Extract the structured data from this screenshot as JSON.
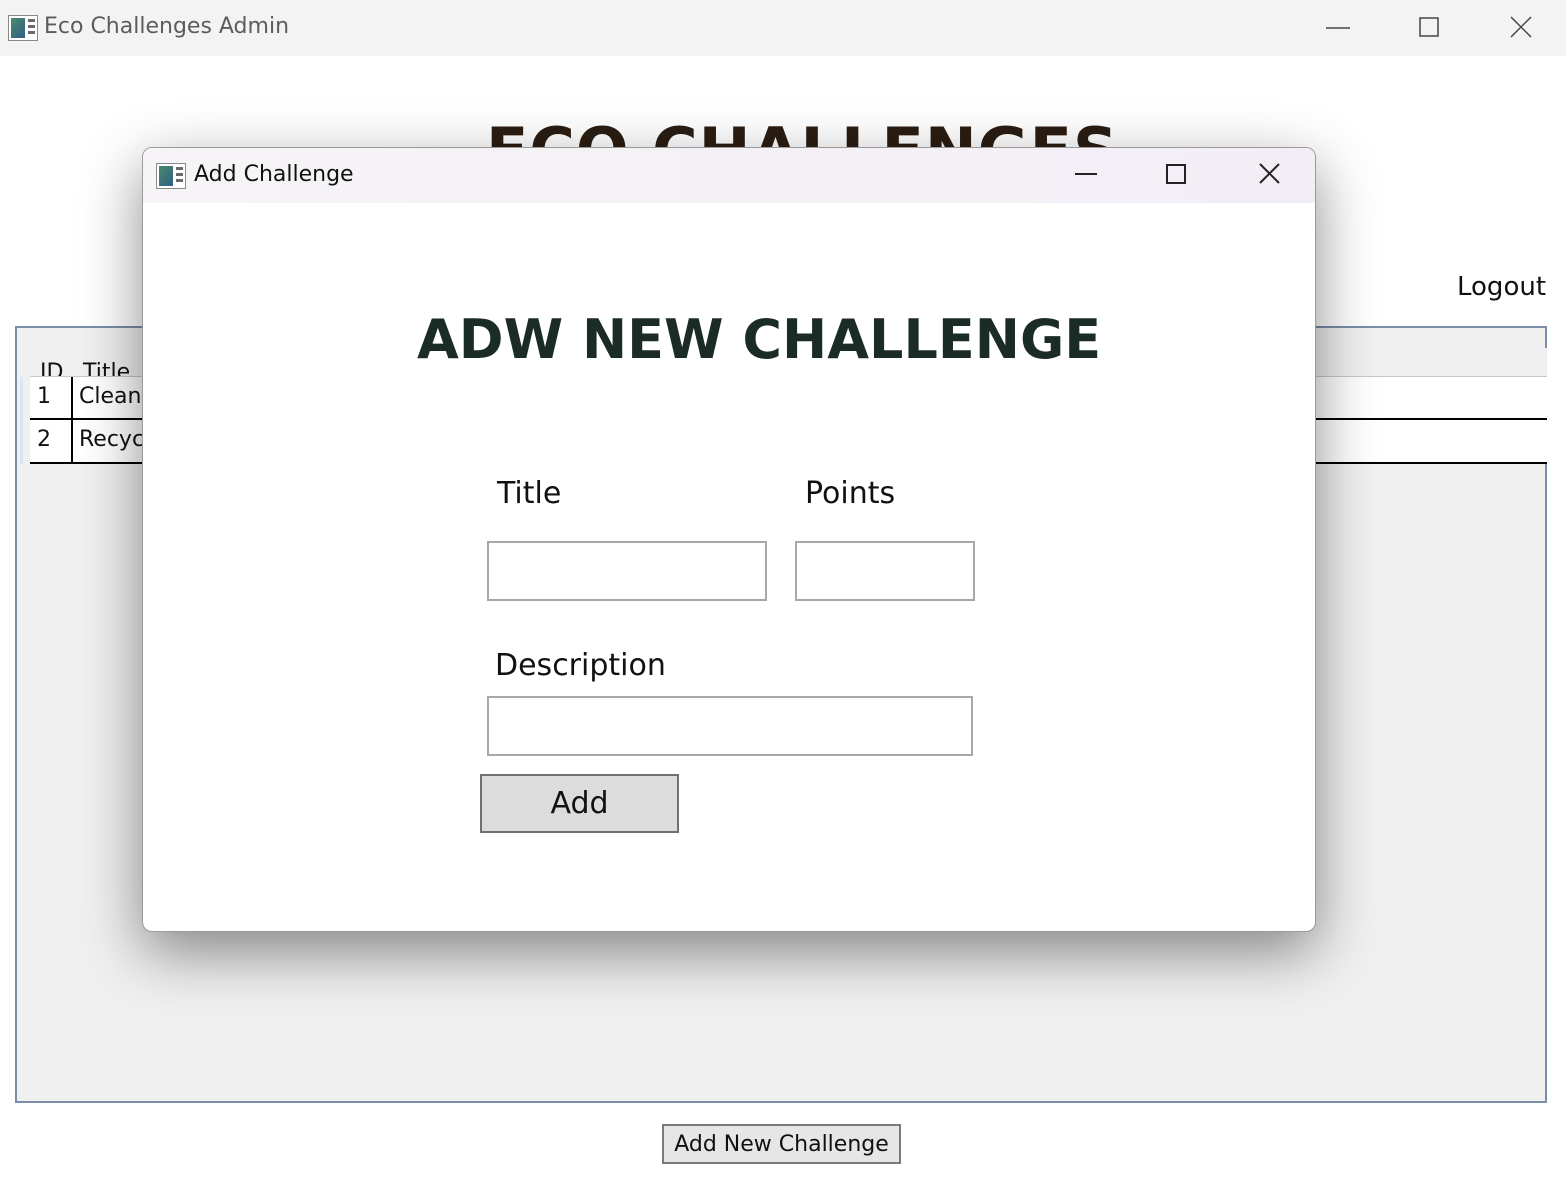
{
  "main_window": {
    "title": "Eco Challenges Admin",
    "heading": "ECO CHALLENGES",
    "logout_label": "Logout",
    "add_new_button_label": "Add New Challenge",
    "table": {
      "columns": [
        "ID",
        "Title"
      ],
      "rows": [
        {
          "id": "1",
          "title": "Cleani"
        },
        {
          "id": "2",
          "title": "Recycl"
        }
      ]
    }
  },
  "dialog": {
    "title": "Add Challenge",
    "heading": "ADW NEW CHALLENGE",
    "title_label": "Title",
    "points_label": "Points",
    "description_label": "Description",
    "title_value": "",
    "points_value": "",
    "description_value": "",
    "add_button_label": "Add"
  },
  "icons": {
    "minimize": "minimize-icon",
    "maximize": "maximize-icon",
    "close": "close-icon",
    "app": "app-icon"
  }
}
